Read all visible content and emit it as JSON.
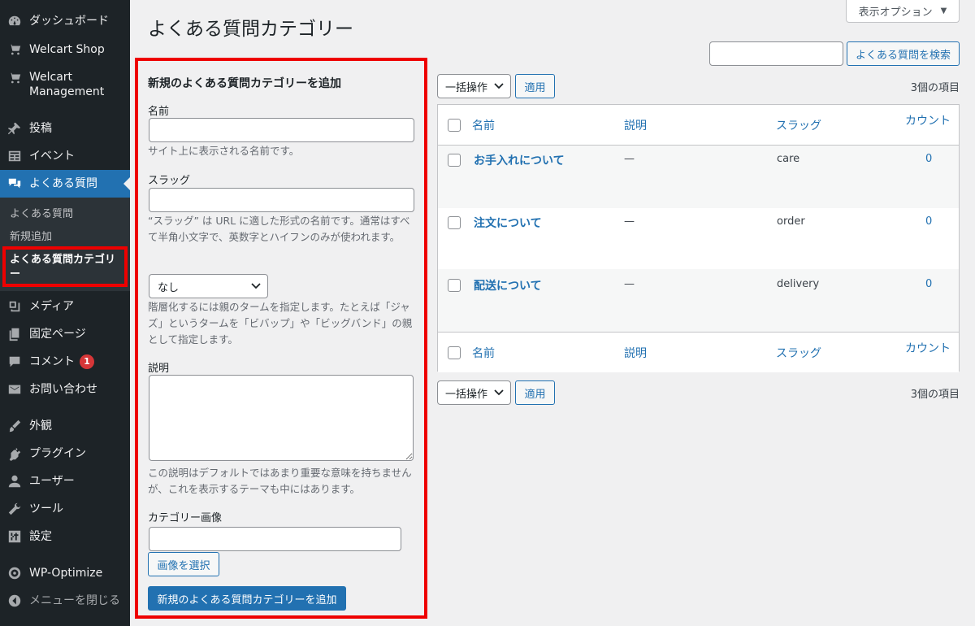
{
  "sidebar": {
    "items": [
      {
        "label": "ダッシュボード",
        "icon": "dashboard-icon"
      },
      {
        "label": "Welcart Shop",
        "icon": "cart-icon"
      },
      {
        "label": "Welcart Management",
        "icon": "cart-icon"
      },
      {
        "label": "投稿",
        "icon": "pin-icon"
      },
      {
        "label": "イベント",
        "icon": "table-icon"
      },
      {
        "label": "よくある質問",
        "icon": "faq-bubbles-icon"
      },
      {
        "label": "メディア",
        "icon": "media-icon"
      },
      {
        "label": "固定ページ",
        "icon": "page-icon"
      },
      {
        "label": "コメント",
        "icon": "comment-icon",
        "badge": "1"
      },
      {
        "label": "お問い合わせ",
        "icon": "mail-icon"
      },
      {
        "label": "外観",
        "icon": "brush-icon"
      },
      {
        "label": "プラグイン",
        "icon": "plugin-icon"
      },
      {
        "label": "ユーザー",
        "icon": "user-icon"
      },
      {
        "label": "ツール",
        "icon": "wrench-icon"
      },
      {
        "label": "設定",
        "icon": "settings-icon"
      },
      {
        "label": "WP-Optimize",
        "icon": "optimize-icon"
      },
      {
        "label": "メニューを閉じる",
        "icon": "collapse-icon"
      }
    ],
    "submenu": [
      "よくある質問",
      "新規追加",
      "よくある質問カテゴリー"
    ]
  },
  "header": {
    "title": "よくある質問カテゴリー",
    "screen_options": "表示オプション",
    "search_button": "よくある質問を検索"
  },
  "form": {
    "heading": "新規のよくある質問カテゴリーを追加",
    "name_label": "名前",
    "name_desc": "サイト上に表示される名前です。",
    "slug_label": "スラッグ",
    "slug_desc": "“スラッグ” は URL に適した形式の名前です。通常はすべて半角小文字で、英数字とハイフンのみが使われます。",
    "parent_value": "なし",
    "parent_desc": "階層化するには親のタームを指定します。たとえば「ジャズ」というタームを「ビバップ」や「ビッグバンド」の親として指定します。",
    "desc_label": "説明",
    "desc_desc": "この説明はデフォルトではあまり重要な意味を持ちませんが、これを表示するテーマも中にはあります。",
    "image_label": "カテゴリー画像",
    "image_button": "画像を選択",
    "submit": "新規のよくある質問カテゴリーを追加"
  },
  "table": {
    "bulk_action": "一括操作",
    "apply": "適用",
    "count": "3個の項目",
    "columns": {
      "name": "名前",
      "description": "説明",
      "slug": "スラッグ",
      "count": "カウント"
    },
    "rows": [
      {
        "name": "お手入れについて",
        "description": "—",
        "slug": "care",
        "count": "0"
      },
      {
        "name": "注文について",
        "description": "—",
        "slug": "order",
        "count": "0"
      },
      {
        "name": "配送について",
        "description": "—",
        "slug": "delivery",
        "count": "0"
      }
    ]
  }
}
